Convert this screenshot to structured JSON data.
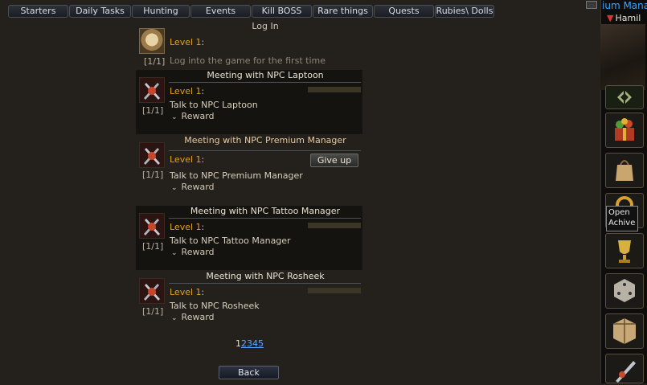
{
  "tabs": [
    {
      "label": "Starters"
    },
    {
      "label": "Daily Tasks"
    },
    {
      "label": "Hunting"
    },
    {
      "label": "Events"
    },
    {
      "label": "Kill BOSS"
    },
    {
      "label": "Rare things"
    },
    {
      "label": "Quests"
    },
    {
      "label": "Rubies\\ Dolls"
    }
  ],
  "login": {
    "title": "Log In",
    "progress": "[1/1]",
    "level_text": "Level 1",
    "colon": ":",
    "description": "Log into the game for the first time"
  },
  "quests": [
    {
      "title": "Meeting with NPC Laptoon",
      "progress": "[1/1]",
      "level_text": "Level 1",
      "colon": ":",
      "task": "Talk to NPC Laptoon",
      "reward": "Reward"
    },
    {
      "title": "Meeting with NPC Premium Manager",
      "progress": "[1/1]",
      "level_text": "Level 1",
      "colon": ":",
      "task": "Talk to NPC Premium Manager",
      "reward": "Reward",
      "action": "Give up"
    },
    {
      "title": "Meeting with NPC Tattoo Manager",
      "progress": "[1/1]",
      "level_text": "Level 1",
      "colon": ":",
      "task": "Talk to NPC Tattoo Manager",
      "reward": "Reward"
    },
    {
      "title": "Meeting with NPC Rosheek",
      "progress": "[1/1]",
      "level_text": "Level 1",
      "colon": ":",
      "task": "Talk to NPC Rosheek",
      "reward": "Reward"
    }
  ],
  "pagination": {
    "current": "1",
    "pages": [
      "2",
      "3",
      "4",
      "5"
    ]
  },
  "back_label": "Back",
  "side": {
    "name_partial": "ium Mana",
    "player_partial": "Hamil",
    "tooltip": "Open Achive"
  },
  "colors": {
    "level_accent": "#e0a020",
    "link": "#5aa8ff",
    "side_name": "#3aa6ff"
  }
}
